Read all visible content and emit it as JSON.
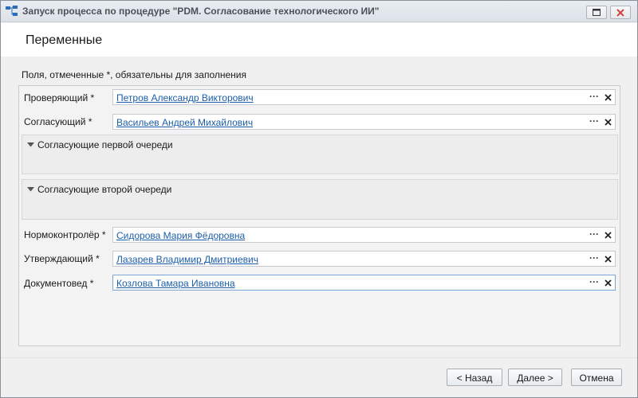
{
  "window": {
    "title": "Запуск процесса по процедуре \"PDM. Согласование технологического ИИ\""
  },
  "header": {
    "title": "Переменные"
  },
  "hint": "Поля, отмеченные *, обязательны для заполнения",
  "fields": [
    {
      "label": "Проверяющий *",
      "value": "Петров Александр Викторович"
    },
    {
      "label": "Согласующий *",
      "value": "Васильев Андрей Михайлович"
    },
    {
      "label": "Нормоконтролёр *",
      "value": "Сидорова Мария Фёдоровна"
    },
    {
      "label": "Утверждающий *",
      "value": "Лазарев Владимир Дмитриевич"
    },
    {
      "label": "Документовед *",
      "value": "Козлова Тамара Ивановна"
    }
  ],
  "groups": [
    {
      "label": "Согласующие первой очереди"
    },
    {
      "label": "Согласующие второй очереди"
    }
  ],
  "field_buttons": {
    "browse": "···"
  },
  "icons": {
    "app": "process-tree-icon",
    "maximize": "maximize-icon",
    "close": "close-icon",
    "clear": "clear-x-icon",
    "expand": "caret-down-icon"
  },
  "footer": {
    "back_label": "< Назад",
    "next_label": "Далее >",
    "cancel_label": "Отмена"
  },
  "colors": {
    "link": "#1c5ea8",
    "close_button": "#d0463c",
    "focus_border": "#7aa6d6"
  }
}
